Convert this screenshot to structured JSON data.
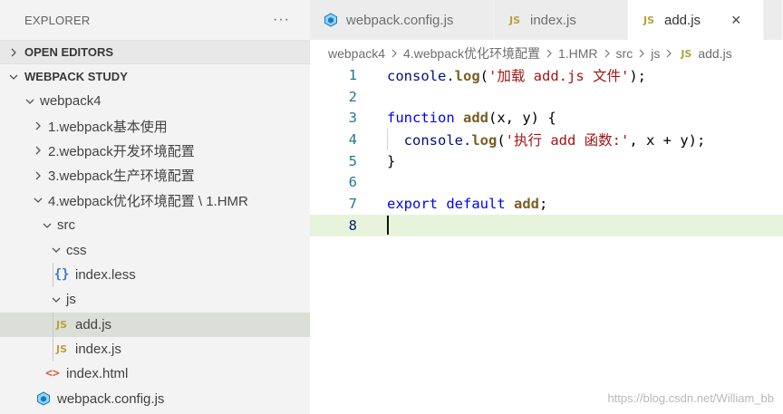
{
  "explorer": {
    "title": "EXPLORER",
    "more": "···",
    "sections": {
      "open_editors": "OPEN EDITORS",
      "workspace": "WEBPACK STUDY"
    },
    "tree": {
      "root": "webpack4",
      "f1": "1.webpack基本使用",
      "f2": "2.webpack开发环境配置",
      "f3": "3.webpack生产环境配置",
      "f4": "4.webpack优化环境配置 \\ 1.HMR",
      "src": "src",
      "css": "css",
      "index_less": "index.less",
      "js": "js",
      "add_js": "add.js",
      "index_js": "index.js",
      "index_html": "index.html",
      "webpack_config": "webpack.config.js"
    }
  },
  "tabs": [
    {
      "label": "webpack.config.js",
      "active": false
    },
    {
      "label": "index.js",
      "active": false
    },
    {
      "label": "add.js",
      "active": true
    }
  ],
  "icons": {
    "js": "JS",
    "css": "{}",
    "html": "<>",
    "close": "×"
  },
  "breadcrumb": [
    "webpack4",
    "4.webpack优化环境配置",
    "1.HMR",
    "src",
    "js",
    "add.js"
  ],
  "editor": {
    "line_numbers": [
      "1",
      "2",
      "3",
      "4",
      "5",
      "6",
      "7",
      "8"
    ],
    "lines": {
      "l1": {
        "a": "console.",
        "b": "log",
        "c": "(",
        "d": "'加载 add.js 文件'",
        "e": ");"
      },
      "l3": {
        "a": "function",
        "b": " ",
        "c": "add",
        "d": "(x, y) {"
      },
      "l4": {
        "a": "  console.",
        "b": "log",
        "c": "(",
        "d": "'执行 add 函数:'",
        "e": ", x + y);"
      },
      "l5": {
        "a": "}"
      },
      "l7": {
        "a": "export",
        "b": " ",
        "c": "default",
        "d": " ",
        "e": "add",
        "f": ";"
      }
    }
  },
  "watermark": "https://blog.csdn.net/William_bb",
  "colors": {
    "sidebar_bg": "#f3f3f3",
    "selected_row": "#dcdfd8",
    "current_line": "#e8f3dc",
    "keyword": "#0000ff",
    "function": "#795e26",
    "string": "#a31515"
  }
}
